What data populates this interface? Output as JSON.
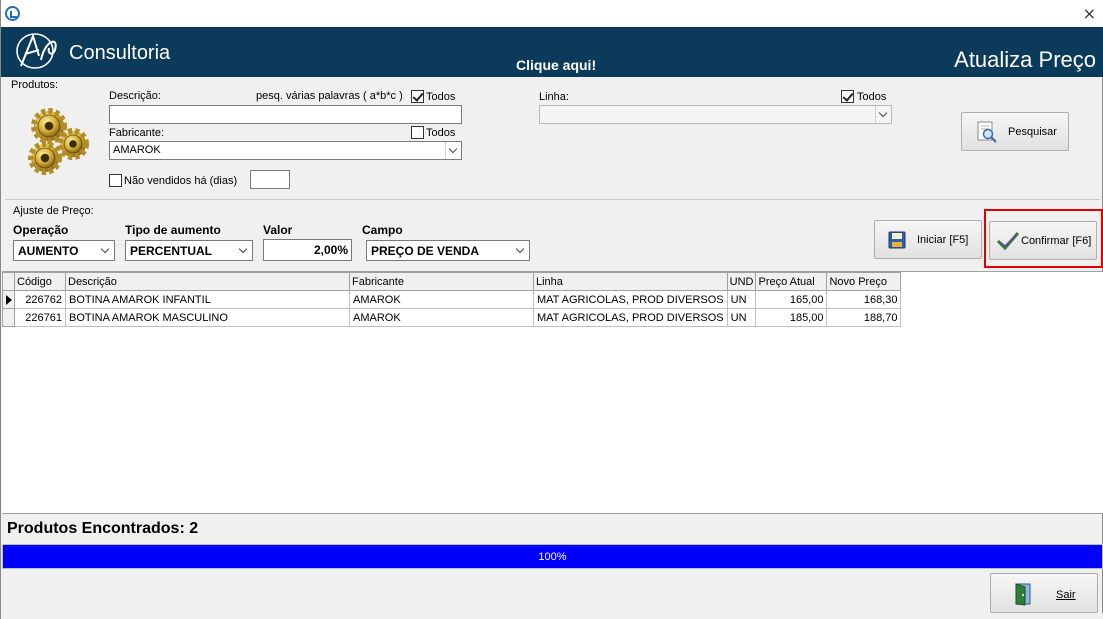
{
  "window": {
    "close_label": "×"
  },
  "banner": {
    "brand": "Consultoria",
    "clique": "Clique aqui!",
    "screen_title": "Atualiza Preço"
  },
  "produtos": {
    "group_label": "Produtos:",
    "descricao_label": "Descrição:",
    "descricao_value": "",
    "hint": "pesq. várias palavras ( a*b*c )",
    "todos_descricao": {
      "label": "Todos",
      "checked": true
    },
    "fabricante_label": "Fabricante:",
    "todos_fabricante": {
      "label": "Todos",
      "checked": false
    },
    "fabricante_value": "AMAROK",
    "nao_vendidos": {
      "label": "Não vendidos há (dias)",
      "checked": false,
      "value": ""
    },
    "linha_label": "Linha:",
    "linha_value": "",
    "todos_linha": {
      "label": "Todos",
      "checked": true
    },
    "pesquisar_label": "Pesquisar"
  },
  "ajuste": {
    "group_label": "Ajuste de Preço:",
    "operacao_label": "Operação",
    "operacao_value": "AUMENTO",
    "tipo_label": "Tipo de aumento",
    "tipo_value": "PERCENTUAL",
    "valor_label": "Valor",
    "valor_value": "2,00%",
    "campo_label": "Campo",
    "campo_value": "PREÇO DE VENDA",
    "iniciar_label": "Iniciar [F5]",
    "confirmar_label": "Confirmar [F6]"
  },
  "grid": {
    "columns": [
      "Código",
      "Descrição",
      "Fabricante",
      "Linha",
      "UND",
      "Preço Atual",
      "Novo Preço"
    ],
    "rows": [
      [
        "226762",
        "BOTINA AMAROK INFANTIL",
        "AMAROK",
        "MAT AGRICOLAS, PROD DIVERSOS",
        "UN",
        "165,00",
        "168,30"
      ],
      [
        "226761",
        "BOTINA AMAROK MASCULINO",
        "AMAROK",
        "MAT AGRICOLAS, PROD DIVERSOS",
        "UN",
        "185,00",
        "188,70"
      ]
    ]
  },
  "footer": {
    "found_label": "Produtos Encontrados: 2",
    "progress_text": "100%",
    "progress_fraction": 1.0,
    "sair_label": "Sair"
  },
  "colors": {
    "banner": "#0b3a5a",
    "progress": "#0000ff",
    "highlight": "#e00000"
  }
}
